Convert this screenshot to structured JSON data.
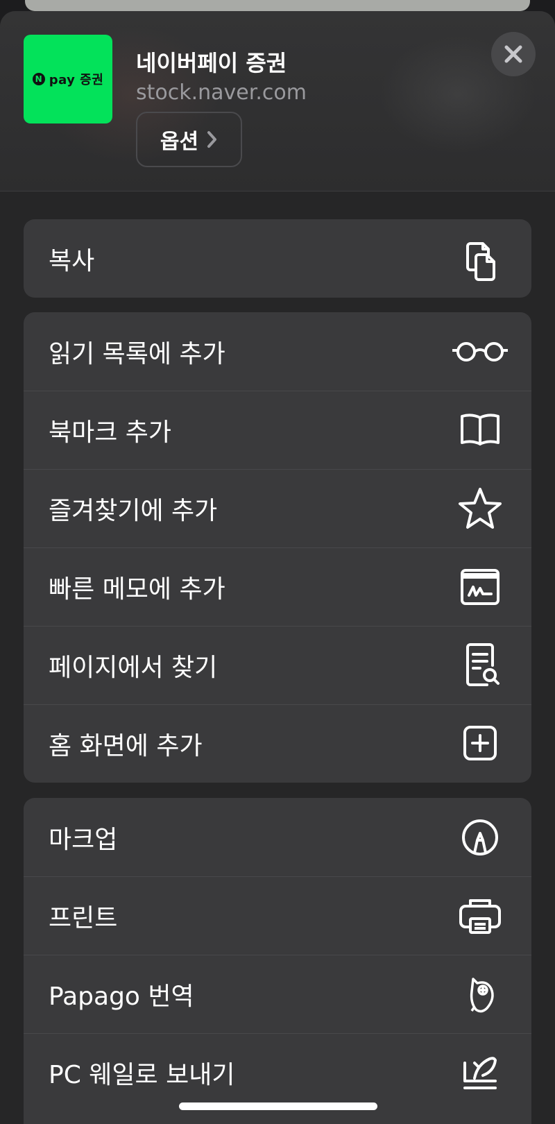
{
  "header": {
    "app_icon": {
      "brand_text": "pay 증권",
      "badge": "N",
      "color": "#03e25a"
    },
    "title": "네이버페이 증권",
    "url": "stock.naver.com",
    "options_label": "옵션"
  },
  "groups": [
    {
      "items": [
        {
          "label": "복사",
          "icon": "copy-icon"
        }
      ]
    },
    {
      "items": [
        {
          "label": "읽기 목록에 추가",
          "icon": "glasses-icon"
        },
        {
          "label": "북마크 추가",
          "icon": "book-icon"
        },
        {
          "label": "즐겨찾기에 추가",
          "icon": "star-icon"
        },
        {
          "label": "빠른 메모에 추가",
          "icon": "quick-note-icon"
        },
        {
          "label": "페이지에서 찾기",
          "icon": "find-in-page-icon"
        },
        {
          "label": "홈 화면에 추가",
          "icon": "plus-square-icon"
        }
      ]
    },
    {
      "items": [
        {
          "label": "마크업",
          "icon": "markup-icon"
        },
        {
          "label": "프린트",
          "icon": "printer-icon"
        },
        {
          "label": "Papago 번역",
          "icon": "papago-icon"
        },
        {
          "label": "PC 웨일로 보내기",
          "icon": "whale-icon"
        }
      ]
    }
  ],
  "colors": {
    "sheet_bg": "#262627",
    "group_bg": "#3a3a3c",
    "accent_green": "#03e25a"
  }
}
